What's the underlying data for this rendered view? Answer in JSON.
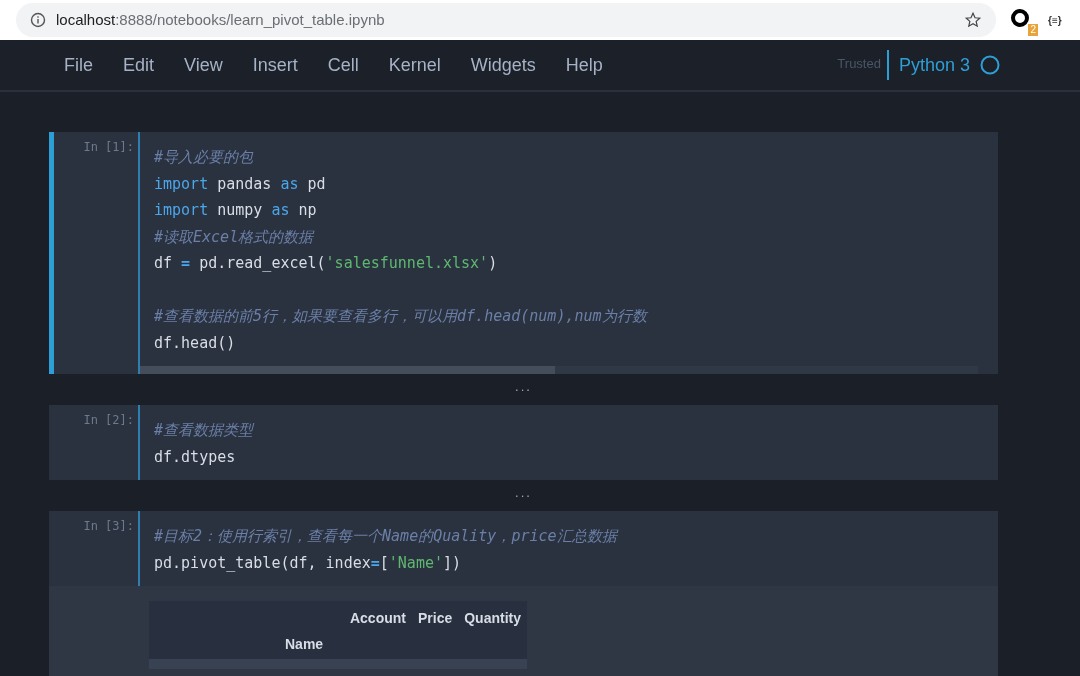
{
  "browser": {
    "url_host": "localhost",
    "url_path": ":8888/notebooks/learn_pivot_table.ipynb",
    "extension_badge": "2",
    "extension_label": "{≡}"
  },
  "menu": {
    "items": [
      "File",
      "Edit",
      "View",
      "Insert",
      "Cell",
      "Kernel",
      "Widgets",
      "Help"
    ],
    "trusted": "Trusted",
    "kernel": "Python 3"
  },
  "cells": [
    {
      "prompt": "In [1]:",
      "selected": true,
      "scrollbar": true,
      "output_collapsed": "...",
      "lines": [
        {
          "kind": "code",
          "tokens": [
            {
              "kind": "comment",
              "text": "#导入必要的包"
            }
          ]
        },
        {
          "kind": "code",
          "tokens": [
            {
              "kind": "keyword",
              "text": "import"
            },
            {
              "kind": "name",
              "text": " pandas "
            },
            {
              "kind": "keyword",
              "text": "as"
            },
            {
              "kind": "name",
              "text": " pd"
            }
          ]
        },
        {
          "kind": "code",
          "tokens": [
            {
              "kind": "keyword",
              "text": "import"
            },
            {
              "kind": "name",
              "text": " numpy "
            },
            {
              "kind": "keyword",
              "text": "as"
            },
            {
              "kind": "name",
              "text": " np"
            }
          ]
        },
        {
          "kind": "code",
          "tokens": [
            {
              "kind": "comment",
              "text": "#读取Excel格式的数据"
            }
          ]
        },
        {
          "kind": "code",
          "tokens": [
            {
              "kind": "name",
              "text": "df "
            },
            {
              "kind": "operator",
              "text": "="
            },
            {
              "kind": "name",
              "text": " pd.read_excel("
            },
            {
              "kind": "string",
              "text": "'salesfunnel.xlsx'"
            },
            {
              "kind": "name",
              "text": ")"
            }
          ]
        },
        {
          "kind": "blank"
        },
        {
          "kind": "code",
          "tokens": [
            {
              "kind": "comment",
              "text": "#查看数据的前5行，如果要查看多行，可以用df.head(num),num为行数"
            }
          ]
        },
        {
          "kind": "code",
          "tokens": [
            {
              "kind": "name",
              "text": "df.head()"
            }
          ]
        }
      ]
    },
    {
      "prompt": "In [2]:",
      "selected": false,
      "output_collapsed": "...",
      "lines": [
        {
          "kind": "code",
          "tokens": [
            {
              "kind": "comment",
              "text": "#查看数据类型"
            }
          ]
        },
        {
          "kind": "code",
          "tokens": [
            {
              "kind": "name",
              "text": "df.dtypes"
            }
          ]
        }
      ]
    },
    {
      "prompt": "In [3]:",
      "selected": false,
      "lines": [
        {
          "kind": "code",
          "tokens": [
            {
              "kind": "comment",
              "text": "#目标2：使用行索引，查看每一个Name的Quality，price汇总数据"
            }
          ]
        },
        {
          "kind": "code",
          "tokens": [
            {
              "kind": "name",
              "text": "pd.pivot_table(df, index"
            },
            {
              "kind": "operator",
              "text": "="
            },
            {
              "kind": "name",
              "text": "["
            },
            {
              "kind": "string",
              "text": "'Name'"
            },
            {
              "kind": "name",
              "text": "])"
            }
          ]
        }
      ],
      "output_table": {
        "columns": [
          "Account",
          "Price",
          "Quantity"
        ],
        "index_name": "Name"
      }
    }
  ]
}
